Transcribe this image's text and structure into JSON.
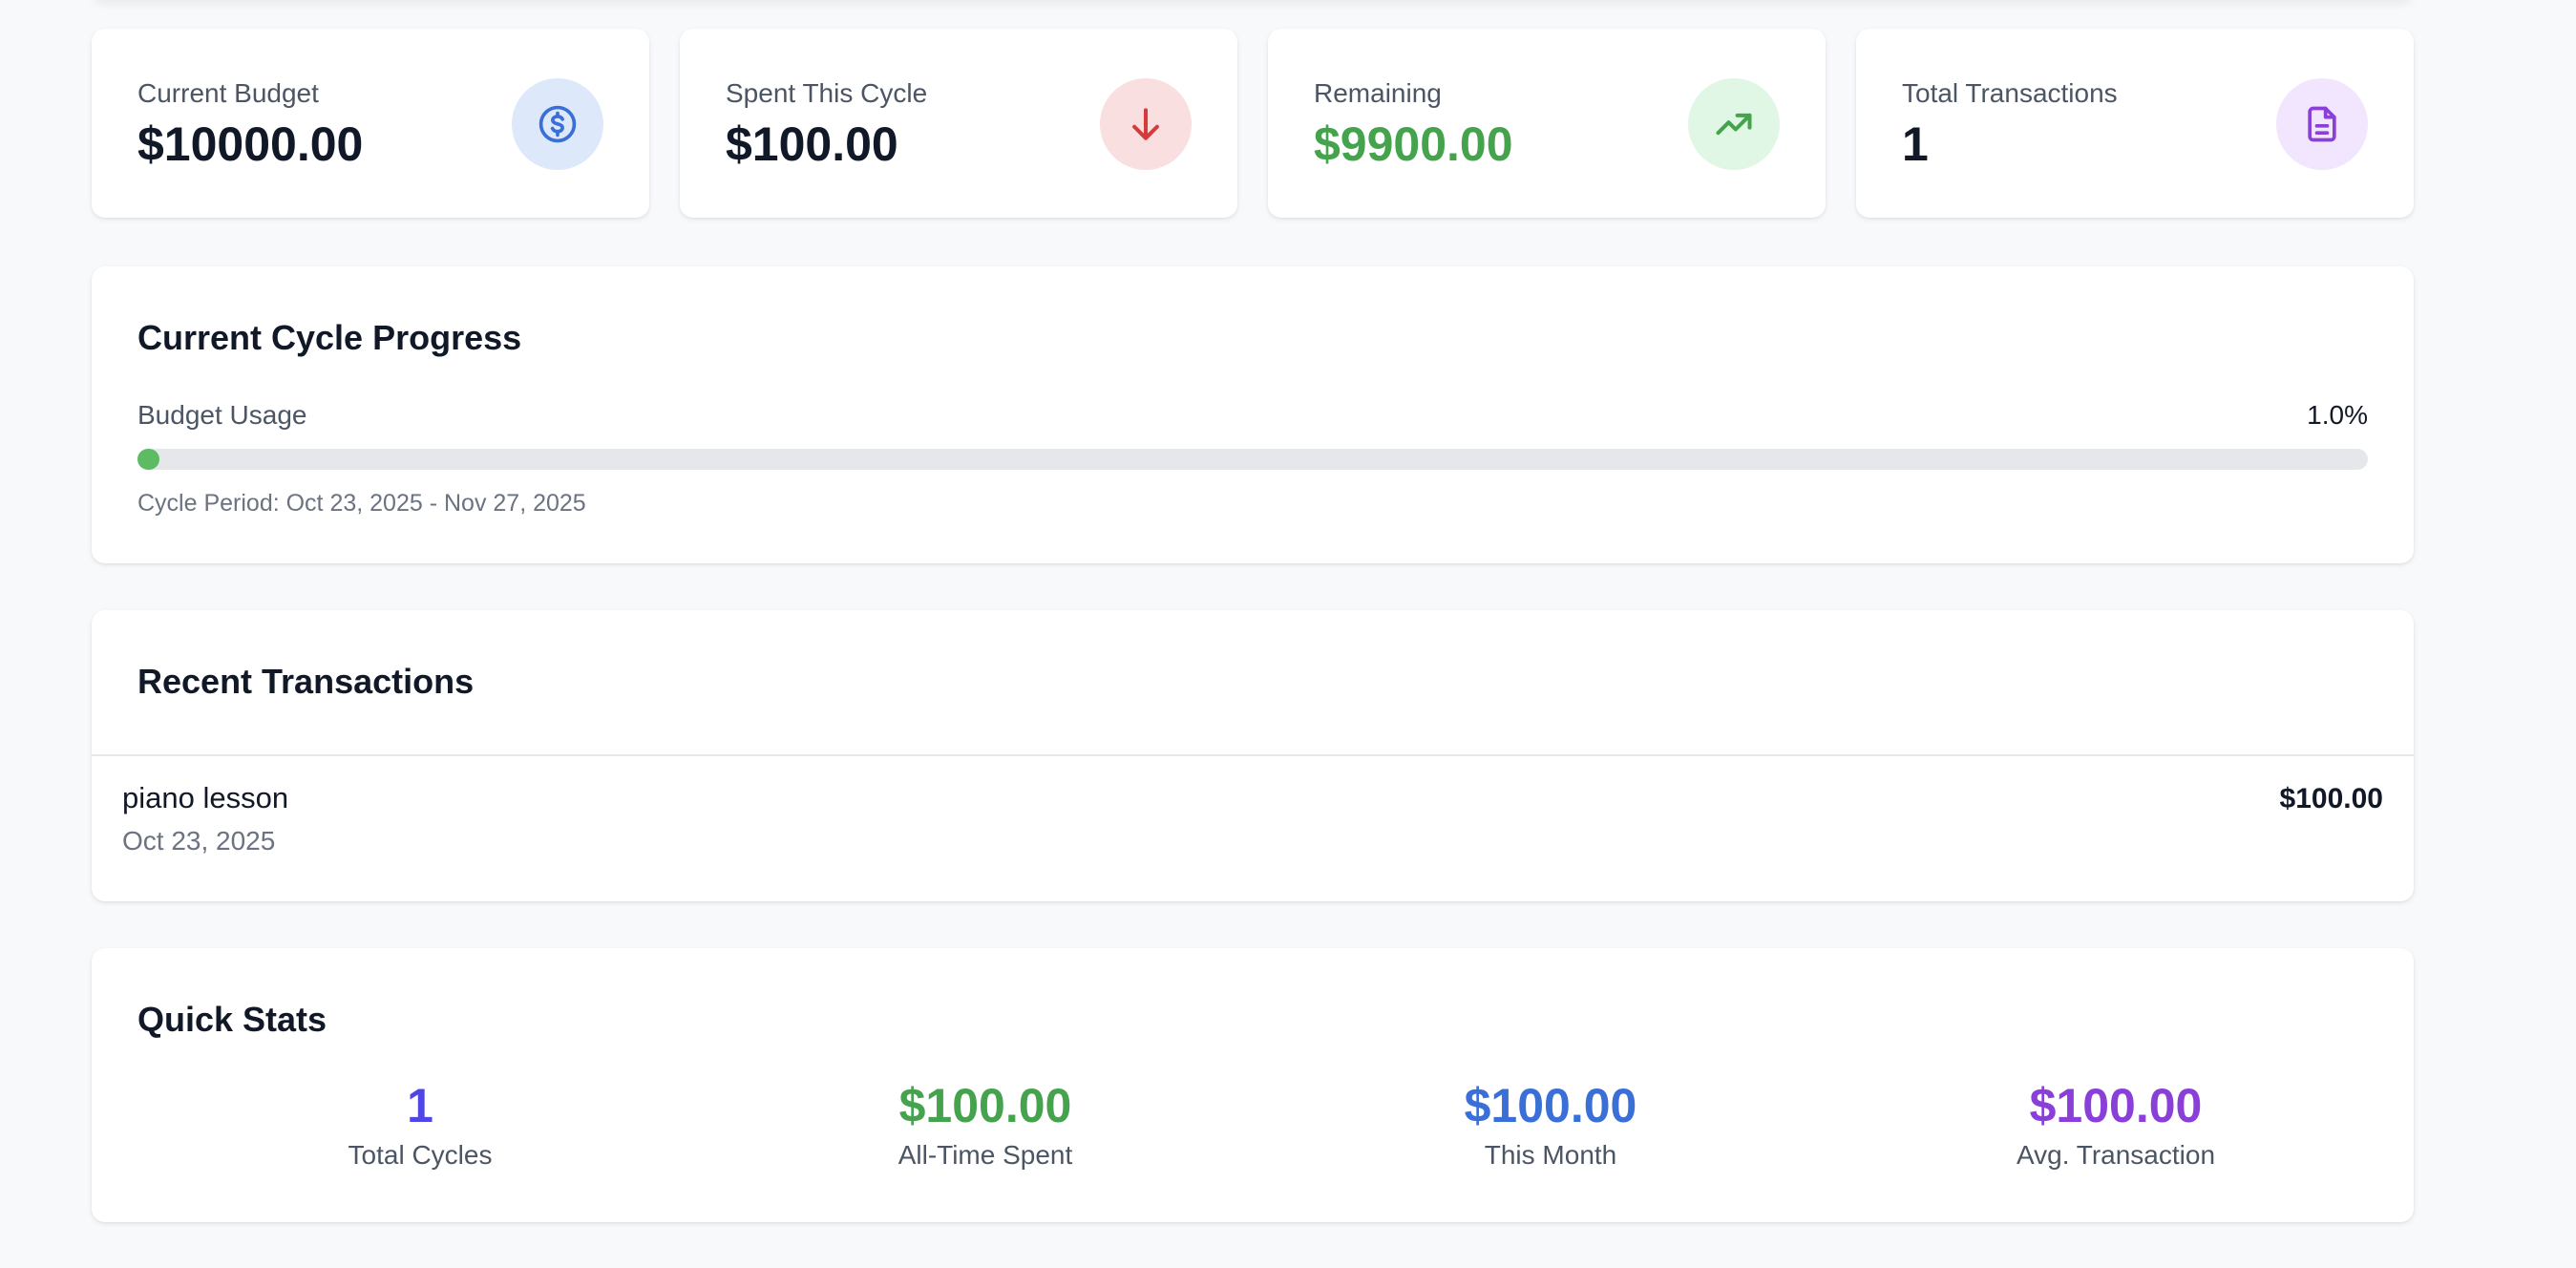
{
  "stats": [
    {
      "label": "Current Budget",
      "value": "$10000.00",
      "icon": "dollar-circle-icon",
      "accent": "#3b6fd8"
    },
    {
      "label": "Spent This Cycle",
      "value": "$100.00",
      "icon": "arrow-down-icon",
      "accent": "#d63a3a"
    },
    {
      "label": "Remaining",
      "value": "$9900.00",
      "icon": "trending-up-icon",
      "accent": "#45a34e"
    },
    {
      "label": "Total Transactions",
      "value": "1",
      "icon": "document-icon",
      "accent": "#8b3fd9"
    }
  ],
  "progress": {
    "title": "Current Cycle Progress",
    "usage_label": "Budget Usage",
    "usage_value": "1.0%",
    "usage_fraction": 0.01,
    "cycle_period": "Cycle Period: Oct 23, 2025 - Nov 27, 2025"
  },
  "recent": {
    "title": "Recent Transactions",
    "items": [
      {
        "description": "piano lesson",
        "date": "Oct 23, 2025",
        "amount": "$100.00"
      }
    ]
  },
  "quick_stats": {
    "title": "Quick Stats",
    "items": [
      {
        "value": "1",
        "label": "Total Cycles",
        "color": "#4f46e5"
      },
      {
        "value": "$100.00",
        "label": "All-Time Spent",
        "color": "#45a34e"
      },
      {
        "value": "$100.00",
        "label": "This Month",
        "color": "#3b6fd8"
      },
      {
        "value": "$100.00",
        "label": "Avg. Transaction",
        "color": "#8b3fd9"
      }
    ]
  }
}
